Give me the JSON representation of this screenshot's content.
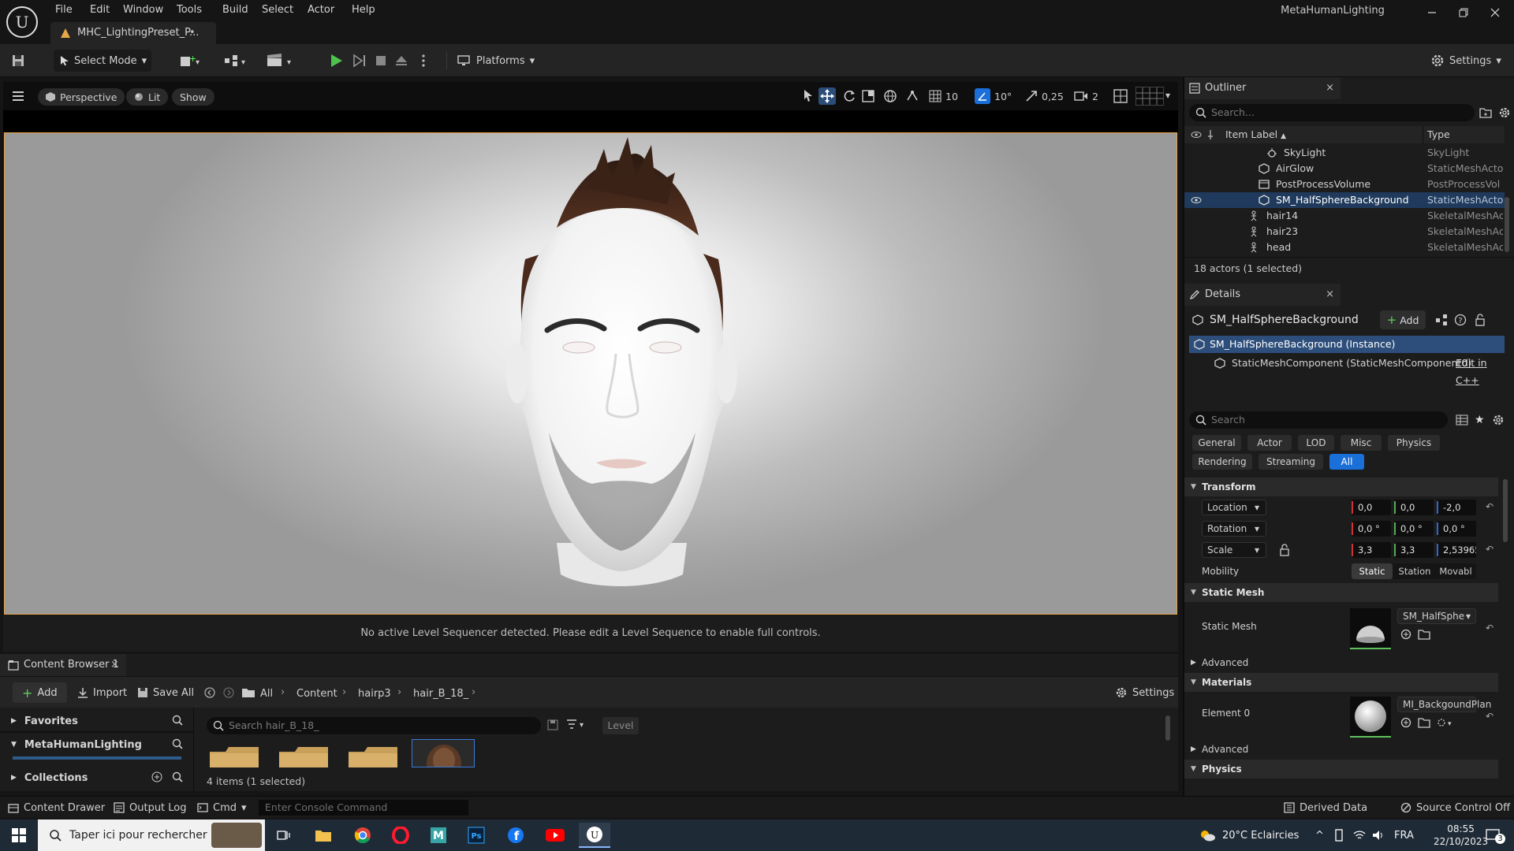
{
  "window": {
    "title": "MetaHumanLighting",
    "asset_tab": "MHC_LightingPreset_P..."
  },
  "menu": [
    "File",
    "Edit",
    "Window",
    "Tools",
    "Build",
    "Select",
    "Actor",
    "Help"
  ],
  "toolbar": {
    "select_mode": "Select Mode",
    "platforms": "Platforms",
    "settings": "Settings"
  },
  "viewport": {
    "perspective": "Perspective",
    "lit": "Lit",
    "show": "Show",
    "grid_snap": "10",
    "rotation_snap": "10°",
    "scale_snap": "0,25",
    "camera_speed": "2",
    "sequencer_msg": "No active Level Sequencer detected. Please edit a Level Sequence to enable full controls."
  },
  "outliner": {
    "tab": "Outliner",
    "search_placeholder": "Search...",
    "col_label": "Item Label",
    "col_type": "Type",
    "rows": [
      {
        "label": "SkyLight",
        "type": "SkyLight"
      },
      {
        "label": "AirGlow",
        "type": "StaticMeshActo"
      },
      {
        "label": "PostProcessVolume",
        "type": "PostProcessVol"
      },
      {
        "label": "SM_HalfSphereBackground",
        "type": "StaticMeshActo"
      },
      {
        "label": "hair14",
        "type": "SkeletalMeshAc"
      },
      {
        "label": "hair23",
        "type": "SkeletalMeshAc"
      },
      {
        "label": "head",
        "type": "SkeletalMeshAc"
      }
    ],
    "status": "18 actors (1 selected)"
  },
  "details": {
    "tab": "Details",
    "actor_name": "SM_HalfSphereBackground",
    "add": "Add",
    "instance": "SM_HalfSphereBackground (Instance)",
    "component": "StaticMeshComponent (StaticMeshComponent0)",
    "edit_cpp": "Edit in C++",
    "search_placeholder": "Search",
    "filters": [
      "General",
      "Actor",
      "LOD",
      "Misc",
      "Physics",
      "Rendering",
      "Streaming",
      "All"
    ],
    "transform": {
      "header": "Transform",
      "location_label": "Location",
      "rotation_label": "Rotation",
      "scale_label": "Scale",
      "location": [
        "0,0",
        "0,0",
        "-2,0"
      ],
      "rotation": [
        "0,0 °",
        "0,0 °",
        "0,0 °"
      ],
      "scale": [
        "3,3",
        "3,3",
        "2,53965"
      ],
      "mobility_label": "Mobility",
      "mobility": [
        "Static",
        "Station",
        "Movabl"
      ]
    },
    "static_mesh": {
      "header": "Static Mesh",
      "label": "Static Mesh",
      "value": "SM_HalfSphe",
      "advanced": "Advanced"
    },
    "materials": {
      "header": "Materials",
      "element_label": "Element 0",
      "value": "MI_BackgoundPlan",
      "advanced": "Advanced"
    },
    "physics_header": "Physics"
  },
  "content_browser": {
    "tab": "Content Browser 1",
    "add": "Add",
    "import": "Import",
    "save_all": "Save All",
    "settings": "Settings",
    "breadcrumbs": [
      "All",
      "Content",
      "hairp3",
      "hair_B_18_"
    ],
    "favorites": "Favorites",
    "project": "MetaHumanLighting",
    "collections": "Collections",
    "search_placeholder": "Search hair_B_18_",
    "level_filter": "Level",
    "items_count": "4 items (1 selected)"
  },
  "statusbar": {
    "content_drawer": "Content Drawer",
    "output_log": "Output Log",
    "cmd": "Cmd",
    "console_placeholder": "Enter Console Command",
    "derived_data": "Derived Data",
    "source_control": "Source Control Off"
  },
  "taskbar": {
    "search_placeholder": "Taper ici pour rechercher",
    "weather": "20°C  Eclaircies",
    "lang": "FRA",
    "time": "08:55",
    "date": "22/10/2023",
    "notifications": "3"
  },
  "colors": {
    "accent": "#1a6fd8",
    "selection": "#e6a546",
    "x_axis": "#c33",
    "y_axis": "#5a5",
    "z_axis": "#36c"
  }
}
